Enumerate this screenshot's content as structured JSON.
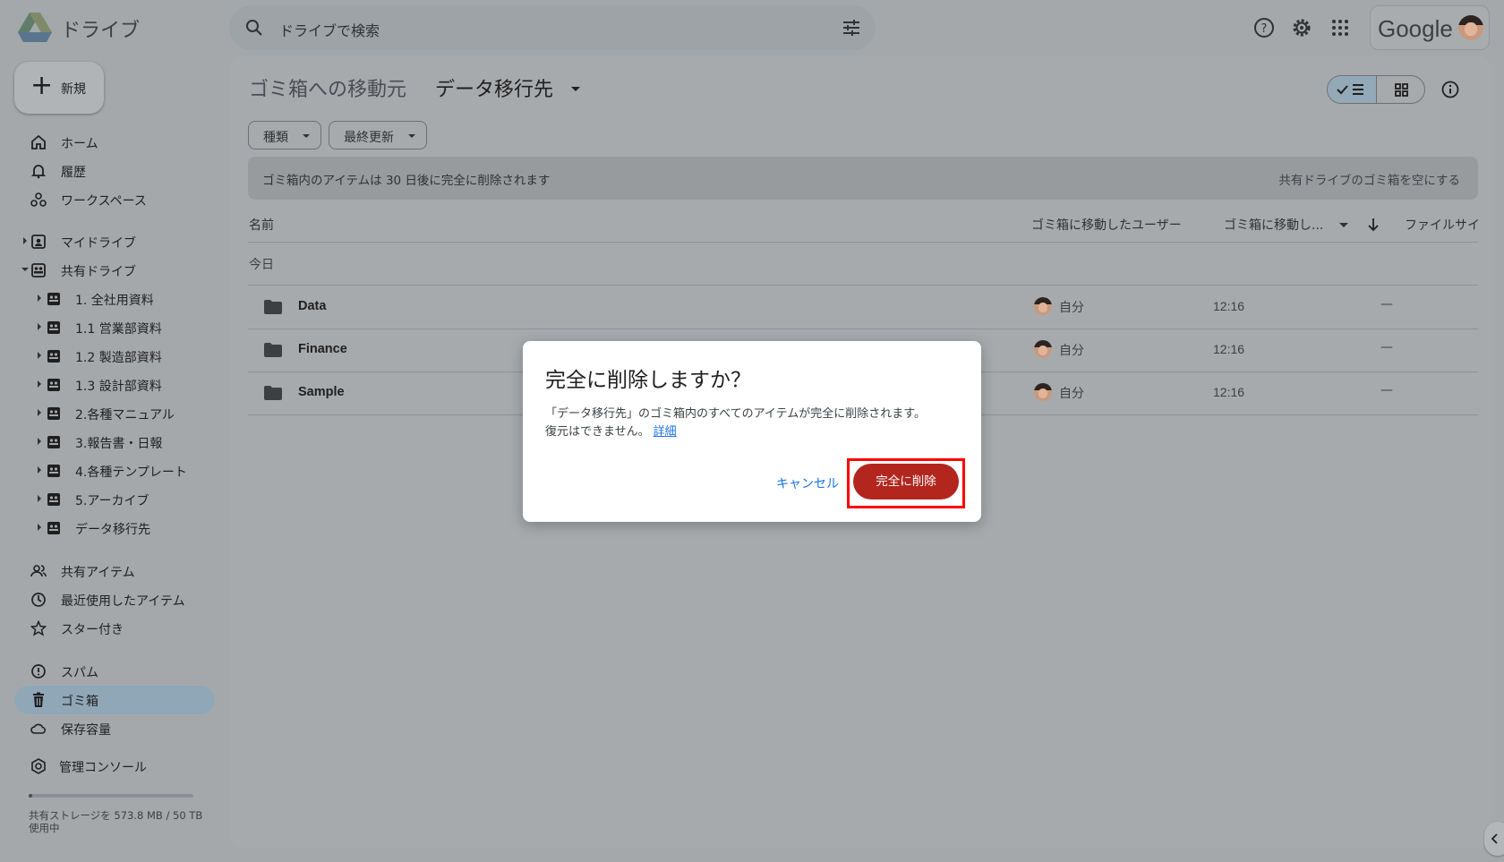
{
  "app": {
    "name": "ドライブ",
    "logo_icon": "google-drive-logo"
  },
  "search": {
    "placeholder": "ドライブで検索"
  },
  "account": {
    "brand": "Google"
  },
  "sidebar": {
    "new_label": "新規",
    "items": [
      {
        "label": "ホーム",
        "icon": "home-icon"
      },
      {
        "label": "履歴",
        "icon": "bell-icon"
      },
      {
        "label": "ワークスペース",
        "icon": "workspace-icon"
      },
      {
        "label": "マイドライブ",
        "icon": "my-drive-icon"
      },
      {
        "label": "共有ドライブ",
        "icon": "shared-drive-icon"
      }
    ],
    "shared_drives": [
      "1. 全社用資料",
      "1.1 営業部資料",
      "1.2 製造部資料",
      "1.3 設計部資料",
      "2.各種マニュアル",
      "3.報告書・日報",
      "4.各種テンプレート",
      "5.アーカイブ",
      "データ移行先"
    ],
    "lower_items": [
      {
        "label": "共有アイテム",
        "icon": "people-icon"
      },
      {
        "label": "最近使用したアイテム",
        "icon": "clock-icon"
      },
      {
        "label": "スター付き",
        "icon": "star-icon"
      },
      {
        "label": "スパム",
        "icon": "spam-icon"
      },
      {
        "label": "ゴミ箱",
        "icon": "trash-icon"
      },
      {
        "label": "保存容量",
        "icon": "cloud-icon"
      },
      {
        "label": "管理コンソール",
        "icon": "admin-icon"
      }
    ],
    "storage": {
      "text": "共有ストレージを 573.8 MB / 50 TB 使用中",
      "used_fraction": 0.02
    }
  },
  "main": {
    "breadcrumb_prefix": "ゴミ箱への移動元",
    "breadcrumb_current": "データ移行先",
    "filters": [
      "種類",
      "最終更新"
    ],
    "banner_text": "ゴミ箱内のアイテムは 30 日後に完全に削除されます",
    "banner_action": "共有ドライブのゴミ箱を空にする",
    "columns": [
      "名前",
      "ゴミ箱に移動したユーザー",
      "ゴミ箱に移動し...",
      "ファイルサイ"
    ],
    "group_label": "今日",
    "rows": [
      {
        "name": "Data",
        "user": "自分",
        "time": "12:16",
        "size": "—"
      },
      {
        "name": "Finance",
        "user": "自分",
        "time": "12:16",
        "size": "—"
      },
      {
        "name": "Sample",
        "user": "自分",
        "time": "12:16",
        "size": "—"
      }
    ]
  },
  "dialog": {
    "title": "完全に削除しますか？",
    "body_line1": "「データ移行先」のゴミ箱内のすべてのアイテムが完全に削除されます。",
    "body_line2": "復元はできません。",
    "link": "詳細",
    "cancel_label": "キャンセル",
    "confirm_label": "完全に削除"
  },
  "colors": {
    "danger": "#b3261e",
    "link": "#1a73e8",
    "highlight": "#ff0000"
  }
}
